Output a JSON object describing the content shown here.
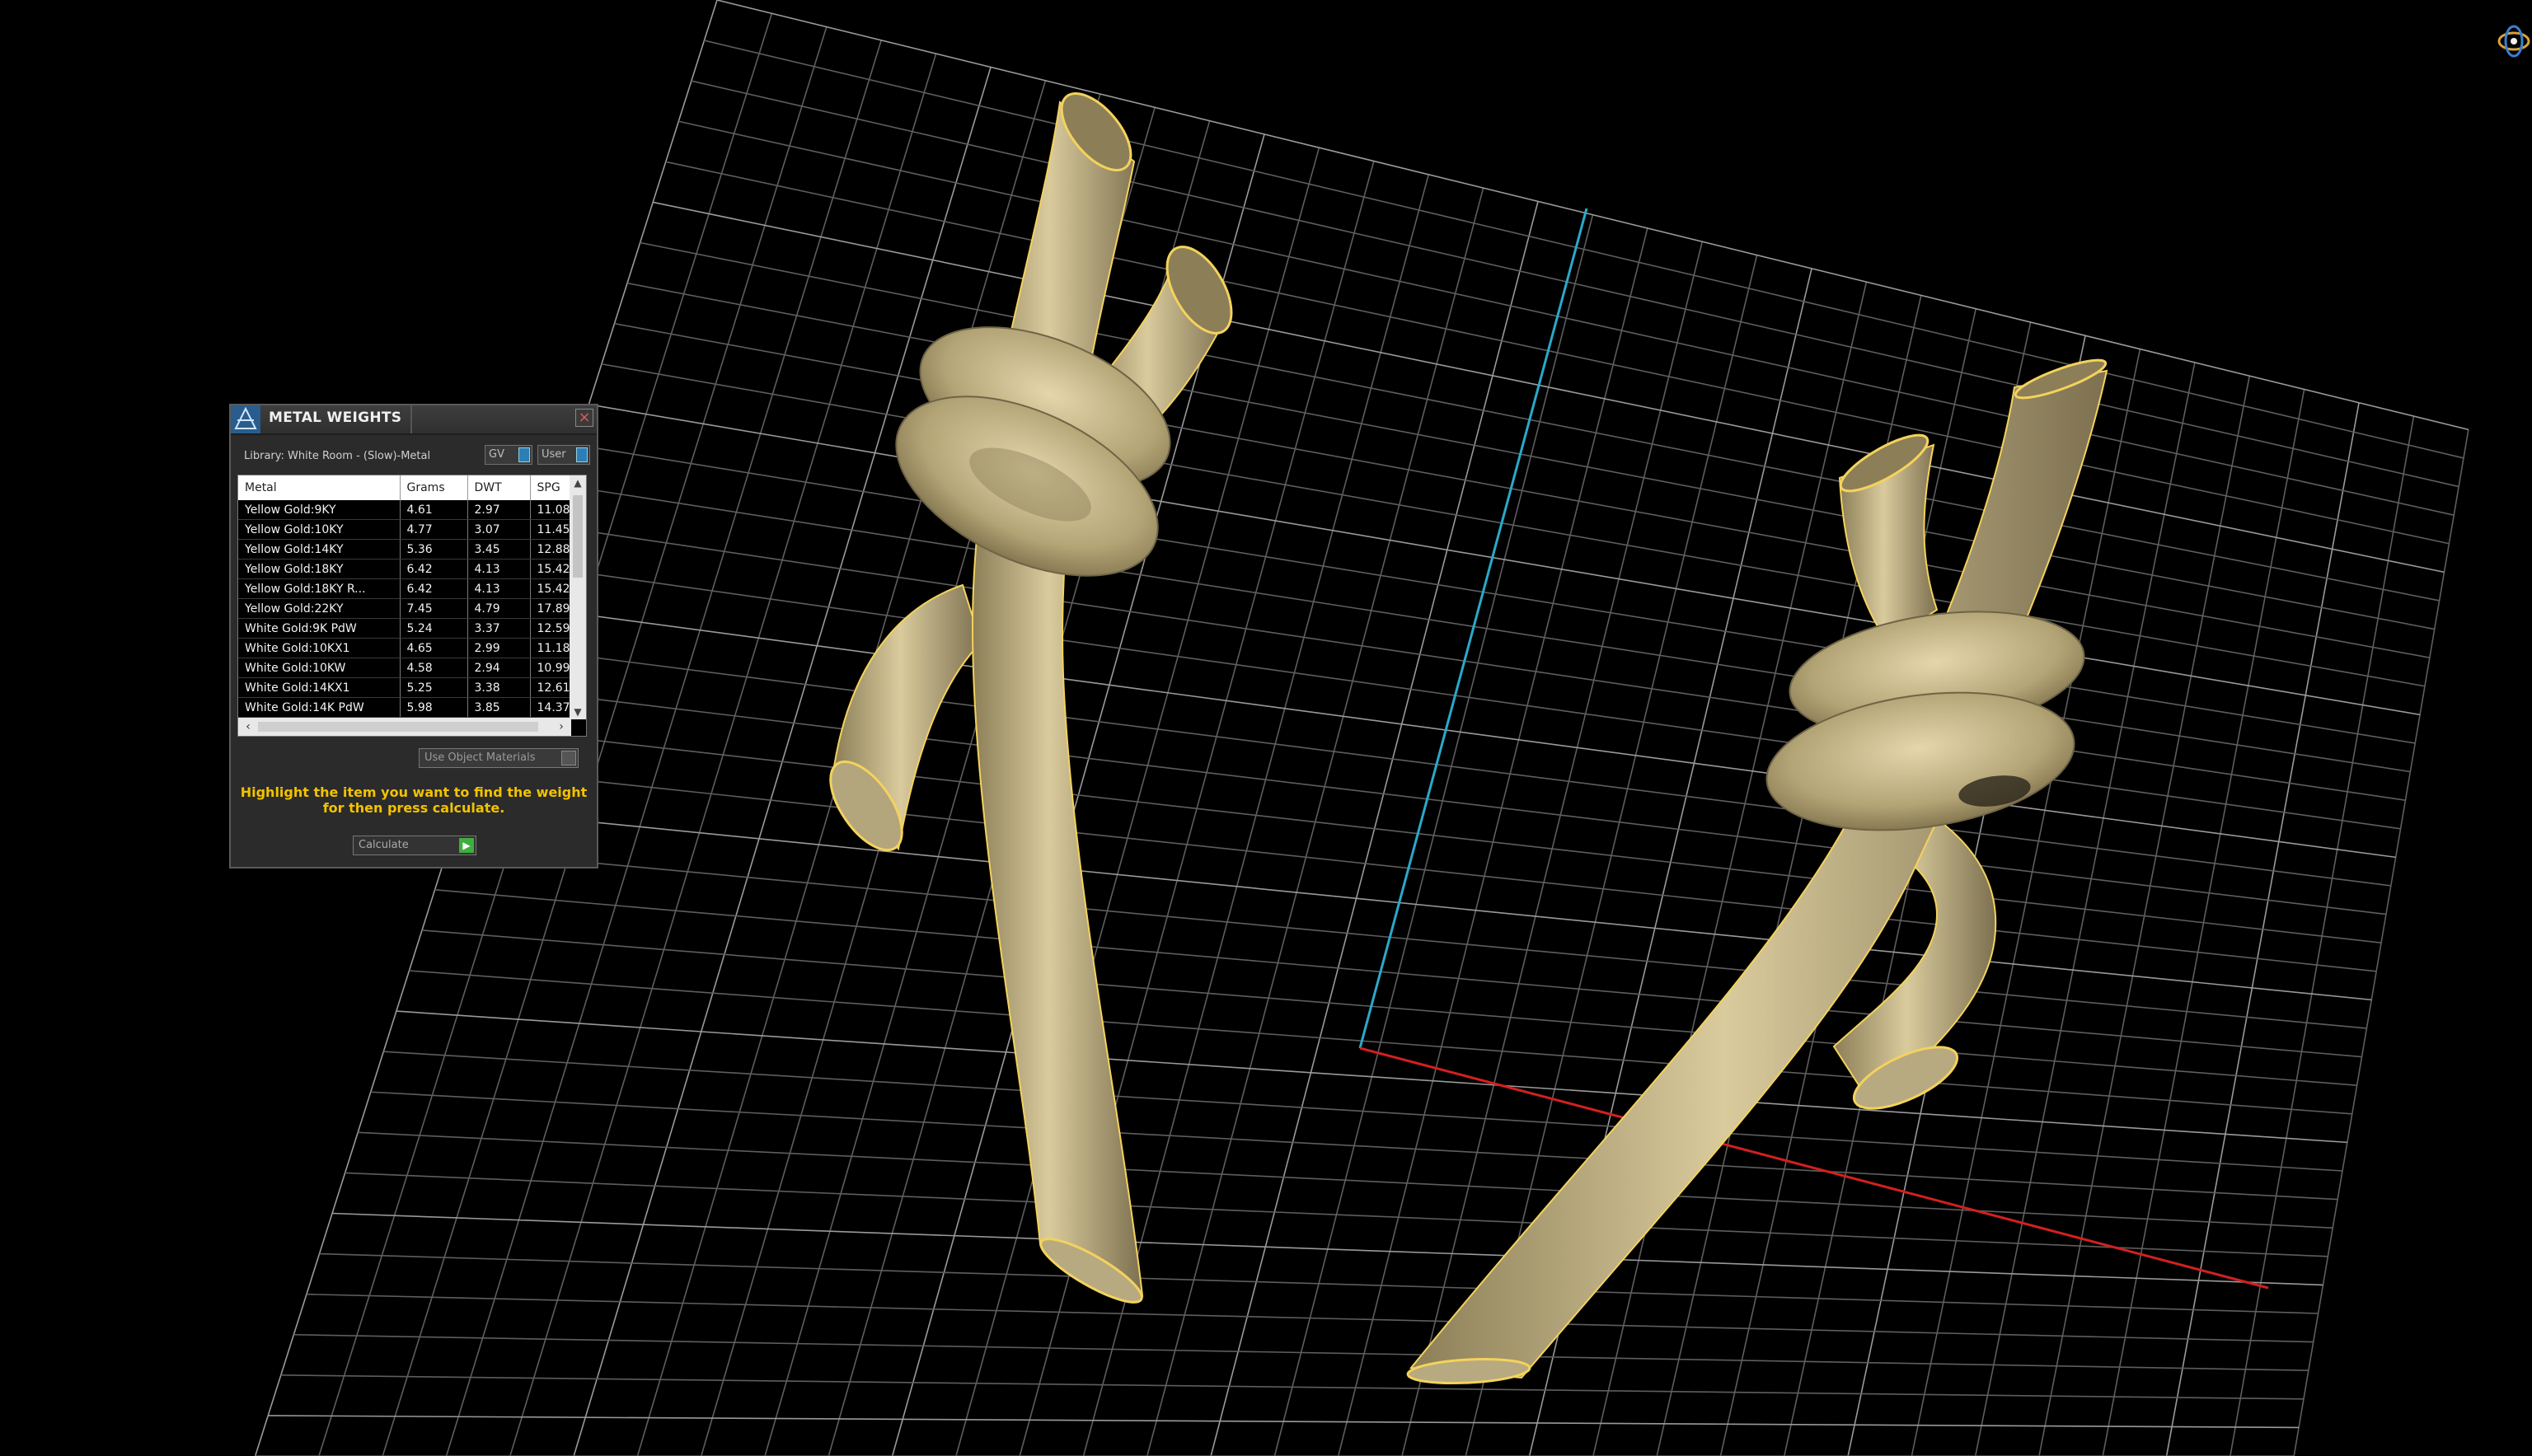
{
  "panel": {
    "title": "METAL WEIGHTS",
    "close_icon": "×",
    "library_label": "Library: White Room - (Slow)-Metal",
    "toggles": {
      "gv": "GV",
      "user": "User"
    },
    "columns": [
      "Metal",
      "Grams",
      "DWT",
      "SPG"
    ],
    "rows": [
      [
        "Yellow Gold:9KY",
        "4.61",
        "2.97",
        "11.08"
      ],
      [
        "Yellow Gold:10KY",
        "4.77",
        "3.07",
        "11.45"
      ],
      [
        "Yellow Gold:14KY",
        "5.36",
        "3.45",
        "12.88"
      ],
      [
        "Yellow Gold:18KY",
        "6.42",
        "4.13",
        "15.42"
      ],
      [
        "Yellow Gold:18KY R...",
        "6.42",
        "4.13",
        "15.42"
      ],
      [
        "Yellow Gold:22KY",
        "7.45",
        "4.79",
        "17.89"
      ],
      [
        "White Gold:9K PdW",
        "5.24",
        "3.37",
        "12.59"
      ],
      [
        "White Gold:10KX1",
        "4.65",
        "2.99",
        "11.18"
      ],
      [
        "White Gold:10KW",
        "4.58",
        "2.94",
        "10.99"
      ],
      [
        "White Gold:14KX1",
        "5.25",
        "3.38",
        "12.61"
      ],
      [
        "White Gold:14K PdW",
        "5.98",
        "3.85",
        "14.37"
      ]
    ],
    "use_object_materials": "Use Object Materials",
    "instructions_line1": "Highlight the item you want to find the weight",
    "instructions_line2": "for then press calculate.",
    "calculate_label": "Calculate"
  },
  "icons": {
    "logo": "metal-weights-logo-icon",
    "close": "close-icon",
    "scroll_up": "chevron-up-icon",
    "scroll_down": "chevron-down-icon",
    "scroll_left": "chevron-left-icon",
    "scroll_right": "chevron-right-icon",
    "run": "play-icon",
    "gizmo": "view-gizmo-icon"
  },
  "colors": {
    "background": "#000000",
    "grid": "#8a8a8a",
    "axis_y": "#2aa9c9",
    "axis_x": "#d22020",
    "metal": "#c9b98a",
    "metal_edge": "#f4d25c",
    "instruction_text": "#f2c200",
    "panel_bg": "#2b2b2b"
  }
}
